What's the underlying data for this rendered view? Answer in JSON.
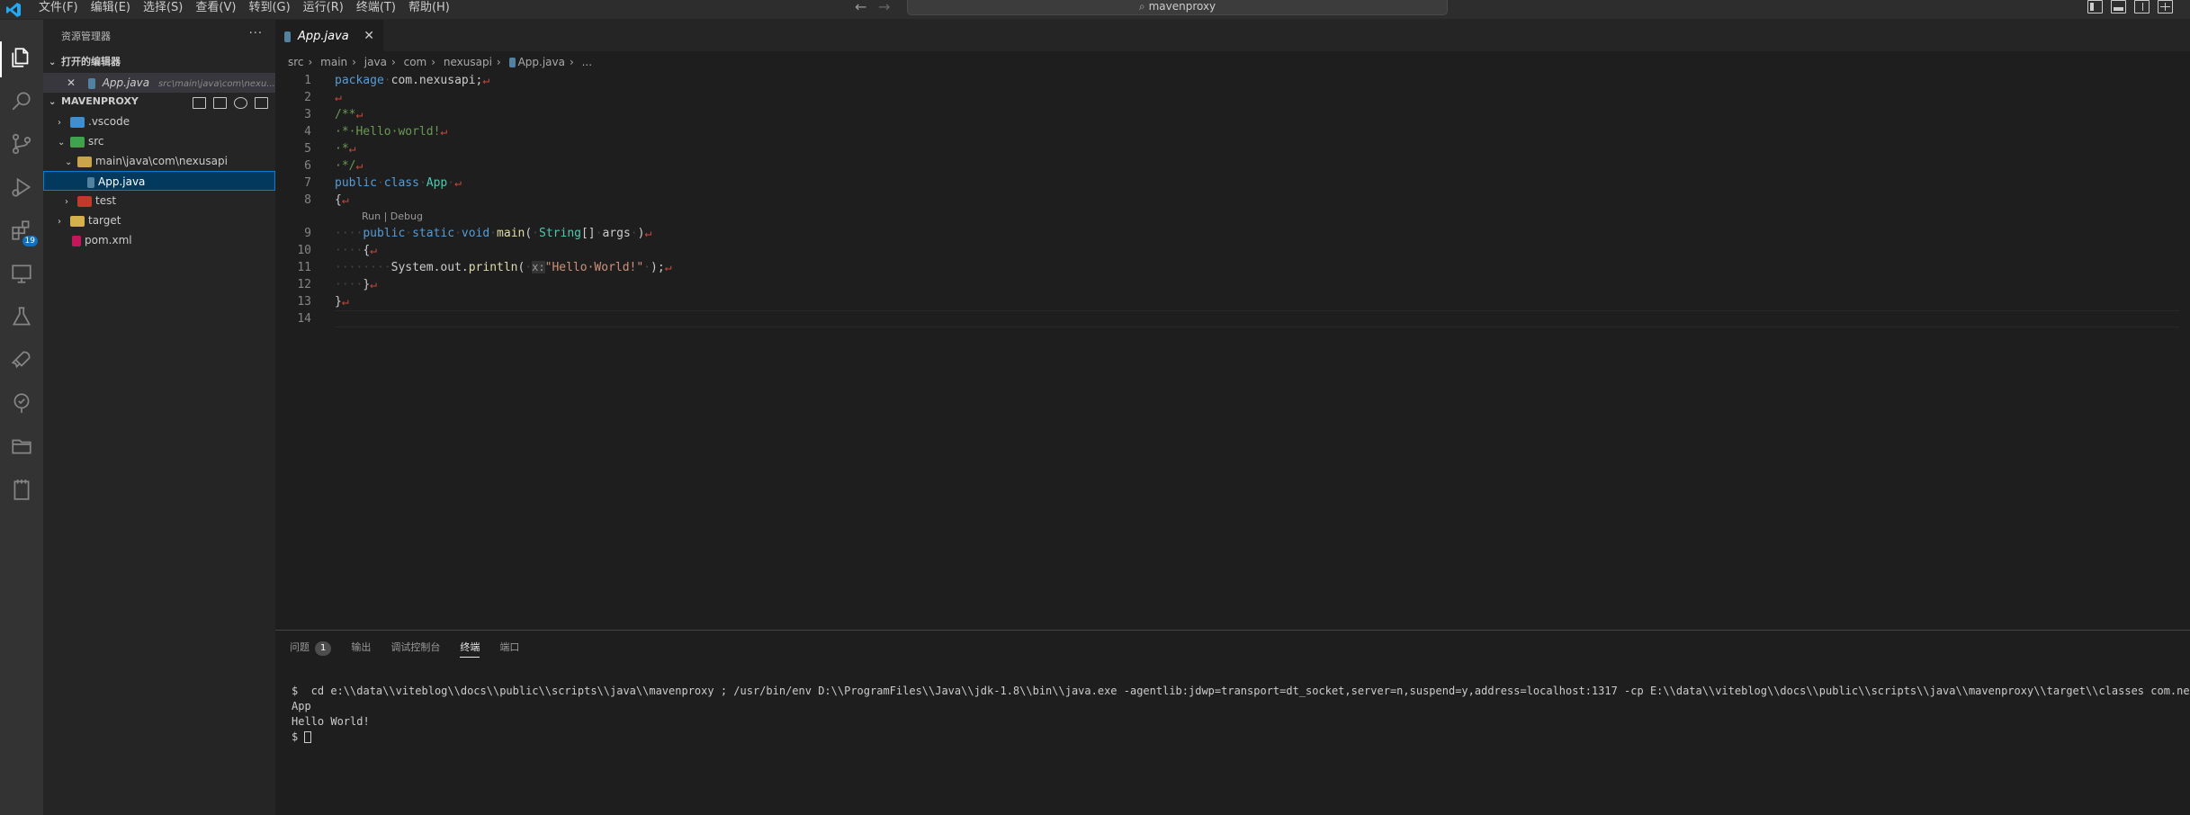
{
  "menubar": [
    "文件(F)",
    "编辑(E)",
    "选择(S)",
    "查看(V)",
    "转到(G)",
    "运行(R)",
    "终端(T)",
    "帮助(H)"
  ],
  "command_center": {
    "text": "mavenproxy"
  },
  "activity_bar": {
    "extensions_badge": "19"
  },
  "sidebar": {
    "title": "资源管理器",
    "open_editors_header": "打开的编辑器",
    "open_editor": {
      "name": "App.java",
      "path": "src\\main\\java\\com\\nexu..."
    },
    "project_header": "MAVENPROXY",
    "tree": [
      {
        "label": ".vscode"
      },
      {
        "label": "src"
      },
      {
        "label": "main\\java\\com\\nexusapi"
      },
      {
        "label": "App.java"
      },
      {
        "label": "test"
      },
      {
        "label": "target"
      },
      {
        "label": "pom.xml"
      }
    ]
  },
  "editor": {
    "tab_label": "App.java",
    "breadcrumb": [
      "src",
      "main",
      "java",
      "com",
      "nexusapi",
      "App.java",
      "..."
    ],
    "codelens": "Run | Debug",
    "lines": [
      {
        "n": "1",
        "html": "<span class=\"kw\">package</span><span class=\"ws\">·</span>com.nexusapi;"
      },
      {
        "n": "2",
        "html": ""
      },
      {
        "n": "3",
        "html": "<span class=\"cm\">/**</span>"
      },
      {
        "n": "4",
        "html": "<span class=\"cm\">·*·Hello·world!</span>"
      },
      {
        "n": "5",
        "html": "<span class=\"cm\">·*</span>"
      },
      {
        "n": "6",
        "html": "<span class=\"cm\">·*/</span>"
      },
      {
        "n": "7",
        "html": "<span class=\"kw\">public</span><span class=\"ws\">·</span><span class=\"kw\">class</span><span class=\"ws\">·</span><span class=\"ty\">App</span><span class=\"ws\">·</span>"
      },
      {
        "n": "8",
        "html": "{"
      },
      {
        "n": "9",
        "html": "<span class=\"ws\">····</span><span class=\"kw\">public</span><span class=\"ws\">·</span><span class=\"kw\">static</span><span class=\"ws\">·</span><span class=\"kw\">void</span><span class=\"ws\">·</span><span class=\"fn\">main</span>(<span class=\"ws\">·</span><span class=\"ty\">String</span>[]<span class=\"ws\">·</span>args<span class=\"ws\">·</span>)"
      },
      {
        "n": "10",
        "html": "<span class=\"ws\">····</span>{"
      },
      {
        "n": "11",
        "html": "<span class=\"ws\">········</span>System.out.<span class=\"fn\">println</span>(<span class=\"ws\">·</span><span class=\"hint\">x:</span><span class=\"str\">\"Hello·World!\"</span><span class=\"ws\">·</span>);"
      },
      {
        "n": "12",
        "html": "<span class=\"ws\">····</span>}"
      },
      {
        "n": "13",
        "html": "}"
      },
      {
        "n": "14",
        "html": ""
      }
    ],
    "eol_marks": [
      true,
      true,
      true,
      true,
      true,
      true,
      true,
      true,
      true,
      true,
      true,
      true,
      true,
      false
    ]
  },
  "panel": {
    "tabs": [
      "问题",
      "输出",
      "调试控制台",
      "终端",
      "端口"
    ],
    "problems_count": "1",
    "active_tab": "终端",
    "terminal_lines": [
      "$  cd e:\\\\data\\\\viteblog\\\\docs\\\\public\\\\scripts\\\\java\\\\mavenproxy ; /usr/bin/env D:\\\\ProgramFiles\\\\Java\\\\jdk-1.8\\\\bin\\\\java.exe -agentlib:jdwp=transport=dt_socket,server=n,suspend=y,address=localhost:1317 -cp E:\\\\data\\\\viteblog\\\\docs\\\\public\\\\scripts\\\\java\\\\mavenproxy\\\\target\\\\classes com.nexusapi.",
      "App",
      "Hello World!",
      "$ "
    ]
  }
}
